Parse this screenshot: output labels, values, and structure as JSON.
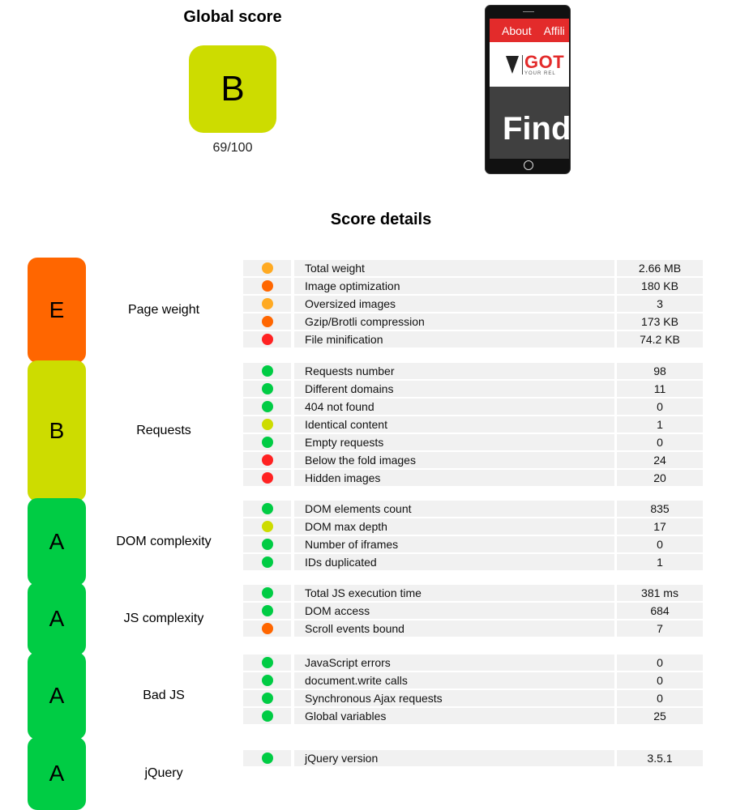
{
  "global": {
    "title": "Global score",
    "grade": "B",
    "grade_color": "#cddc00",
    "score": "69/100"
  },
  "phone_preview": {
    "nav_items": [
      "About",
      "Affili"
    ],
    "logo_text": "GOT",
    "logo_subtext": "YOUR REL",
    "hero_text": "Find",
    "colors": {
      "nav": "#e32b2b",
      "hero_bg": "#404040"
    }
  },
  "details": {
    "title": "Score details",
    "status_colors": {
      "green": "#00cc44",
      "yellow": "#cddc00",
      "light-orange": "#ffaa22",
      "orange": "#ff6600",
      "red": "#ff2222"
    },
    "sections": [
      {
        "label": "Page weight",
        "grade": "E",
        "grade_color": "#ff6600",
        "rows": [
          {
            "status": "light-orange",
            "name": "Total weight",
            "value": "2.66 MB"
          },
          {
            "status": "orange",
            "name": "Image optimization",
            "value": "180 KB"
          },
          {
            "status": "light-orange",
            "name": "Oversized images",
            "value": "3"
          },
          {
            "status": "orange",
            "name": "Gzip/Brotli compression",
            "value": "173 KB"
          },
          {
            "status": "red",
            "name": "File minification",
            "value": "74.2 KB"
          }
        ]
      },
      {
        "label": "Requests",
        "grade": "B",
        "grade_color": "#cddc00",
        "rows": [
          {
            "status": "green",
            "name": "Requests number",
            "value": "98"
          },
          {
            "status": "green",
            "name": "Different domains",
            "value": "11"
          },
          {
            "status": "green",
            "name": "404 not found",
            "value": "0"
          },
          {
            "status": "yellow",
            "name": "Identical content",
            "value": "1"
          },
          {
            "status": "green",
            "name": "Empty requests",
            "value": "0"
          },
          {
            "status": "red",
            "name": "Below the fold images",
            "value": "24"
          },
          {
            "status": "red",
            "name": "Hidden images",
            "value": "20"
          }
        ]
      },
      {
        "label": "DOM complexity",
        "grade": "A",
        "grade_color": "#00cc44",
        "rows": [
          {
            "status": "green",
            "name": "DOM elements count",
            "value": "835"
          },
          {
            "status": "yellow",
            "name": "DOM max depth",
            "value": "17"
          },
          {
            "status": "green",
            "name": "Number of iframes",
            "value": "0"
          },
          {
            "status": "green",
            "name": "IDs duplicated",
            "value": "1"
          }
        ]
      },
      {
        "label": "JS complexity",
        "grade": "A",
        "grade_color": "#00cc44",
        "rows": [
          {
            "status": "green",
            "name": "Total JS execution time",
            "value": "381 ms"
          },
          {
            "status": "green",
            "name": "DOM access",
            "value": "684"
          },
          {
            "status": "orange",
            "name": "Scroll events bound",
            "value": "7"
          }
        ]
      },
      {
        "label": "Bad JS",
        "grade": "A",
        "grade_color": "#00cc44",
        "rows": [
          {
            "status": "green",
            "name": "JavaScript errors",
            "value": "0"
          },
          {
            "status": "green",
            "name": "document.write calls",
            "value": "0"
          },
          {
            "status": "green",
            "name": "Synchronous Ajax requests",
            "value": "0"
          },
          {
            "status": "green",
            "name": "Global variables",
            "value": "25"
          }
        ]
      },
      {
        "label": "jQuery",
        "grade": "A",
        "grade_color": "#00cc44",
        "rows": [
          {
            "status": "green",
            "name": "jQuery version",
            "value": "3.5.1"
          }
        ]
      }
    ]
  }
}
